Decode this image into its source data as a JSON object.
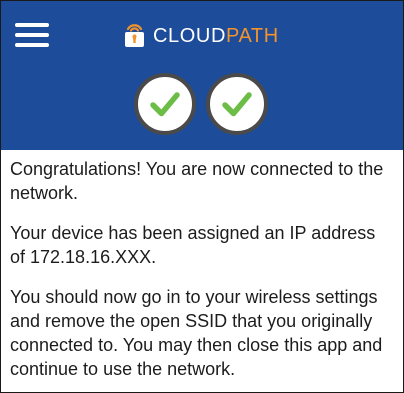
{
  "header": {
    "menu_icon": "hamburger-menu-icon",
    "logo_icon": "padlock-wifi-icon",
    "brand_part1": "CLOUD",
    "brand_part2": "PATH",
    "brand_color_primary": "#ffffff",
    "brand_color_accent": "#f3932b",
    "background_color": "#1c4c9a",
    "status_icons": [
      "check-icon",
      "check-icon"
    ],
    "check_color": "#6cbd45"
  },
  "message": {
    "paragraph1": "Congratulations! You are now connected to the network.",
    "paragraph2": "Your device has been assigned an IP address of 172.18.16.XXX.",
    "paragraph3": "You should now go in to your wireless settings and remove the open SSID that you originally connected to. You may then close this app and continue to use the network."
  }
}
